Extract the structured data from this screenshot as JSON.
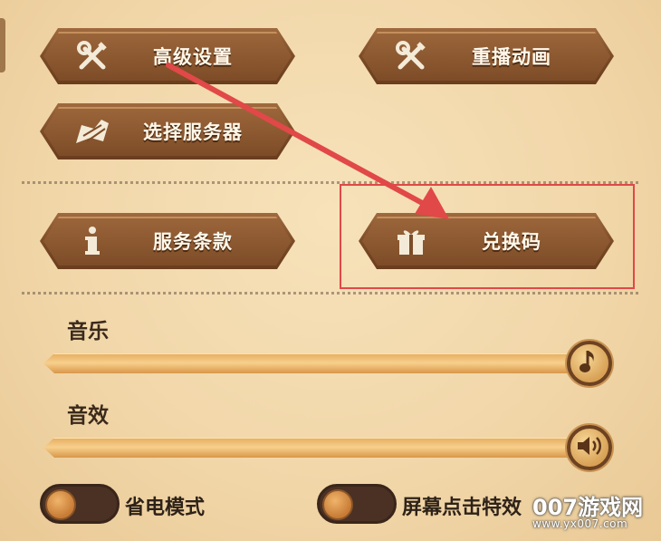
{
  "buttons": {
    "advanced_settings": {
      "label": "高级设置",
      "icon": "wrench-screwdriver-icon"
    },
    "replay_animation": {
      "label": "重播动画",
      "icon": "wrench-screwdriver-icon"
    },
    "select_server": {
      "label": "选择服务器",
      "icon": "map-quill-icon"
    },
    "terms_of_service": {
      "label": "服务条款",
      "icon": "info-icon"
    },
    "redeem_code": {
      "label": "兑换码",
      "icon": "gift-icon"
    }
  },
  "audio": {
    "music": {
      "label": "音乐",
      "level": 1.0,
      "icon": "music-note-icon"
    },
    "sound_effects": {
      "label": "音效",
      "level": 1.0,
      "icon": "speaker-icon"
    }
  },
  "toggles": {
    "power_saving": {
      "label": "省电模式",
      "on": false
    },
    "tap_effects": {
      "label": "屏幕点击特效",
      "on": false
    }
  },
  "watermark": {
    "brand": "007游戏网",
    "url": "www.yx007.com"
  },
  "annotation": {
    "arrow_color": "#e14848",
    "box_color": "#e14848"
  },
  "colors": {
    "button_brown": "#7d4c27",
    "slider_gold": "#f7d08c",
    "background": "#f1d6a8"
  }
}
